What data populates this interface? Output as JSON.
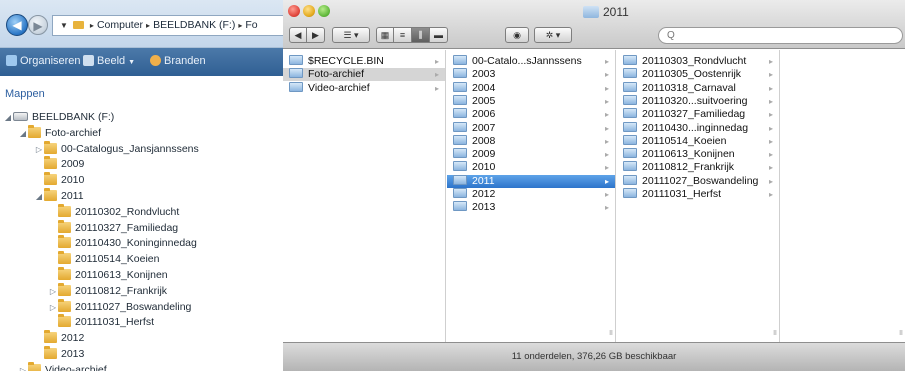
{
  "windows": {
    "address": [
      "Computer",
      "BEELDBANK (F:)",
      "Fo"
    ],
    "toolbar": {
      "organize": "Organiseren",
      "view": "Beeld",
      "burn": "Branden"
    },
    "tree_title": "Mappen",
    "tree": [
      {
        "label": "BEELDBANK (F:)",
        "level": 0,
        "expander": "◢",
        "icon": "drive-icon"
      },
      {
        "label": "Foto-archief",
        "level": 1,
        "expander": "◢",
        "icon": "folder-icon"
      },
      {
        "label": "00-Catalogus_Jansjannssens",
        "level": 2,
        "expander": "▷",
        "icon": "folder-icon"
      },
      {
        "label": "2009",
        "level": 2,
        "expander": "",
        "icon": "folder-icon"
      },
      {
        "label": "2010",
        "level": 2,
        "expander": "",
        "icon": "folder-icon"
      },
      {
        "label": "2011",
        "level": 2,
        "expander": "◢",
        "icon": "folder-icon"
      },
      {
        "label": "20110302_Rondvlucht",
        "level": 3,
        "expander": "",
        "icon": "folder-icon"
      },
      {
        "label": "20110327_Familiedag",
        "level": 3,
        "expander": "",
        "icon": "folder-icon"
      },
      {
        "label": "20110430_Koninginnedag",
        "level": 3,
        "expander": "",
        "icon": "folder-icon"
      },
      {
        "label": "20110514_Koeien",
        "level": 3,
        "expander": "",
        "icon": "folder-icon"
      },
      {
        "label": "20110613_Konijnen",
        "level": 3,
        "expander": "",
        "icon": "folder-icon"
      },
      {
        "label": "20110812_Frankrijk",
        "level": 3,
        "expander": "▷",
        "icon": "folder-icon"
      },
      {
        "label": "20111027_Boswandeling",
        "level": 3,
        "expander": "▷",
        "icon": "folder-icon"
      },
      {
        "label": "20111031_Herfst",
        "level": 3,
        "expander": "",
        "icon": "folder-icon"
      },
      {
        "label": "2012",
        "level": 2,
        "expander": "",
        "icon": "folder-icon"
      },
      {
        "label": "2013",
        "level": 2,
        "expander": "",
        "icon": "folder-icon"
      },
      {
        "label": "Video-archief",
        "level": 1,
        "expander": "▷",
        "icon": "folder-icon"
      }
    ]
  },
  "finder": {
    "title": "2011",
    "search_placeholder": "Q",
    "sidebar": [
      {
        "label": "$RECYCLE.BIN",
        "arrow": "▸",
        "state": ""
      },
      {
        "label": "Foto-archief",
        "arrow": "▸",
        "state": "gray"
      },
      {
        "label": "Video-archief",
        "arrow": "▸",
        "state": ""
      }
    ],
    "col1": [
      {
        "label": "00-Catalo...sJannssens",
        "state": ""
      },
      {
        "label": "2003",
        "state": ""
      },
      {
        "label": "2004",
        "state": ""
      },
      {
        "label": "2005",
        "state": ""
      },
      {
        "label": "2006",
        "state": ""
      },
      {
        "label": "2007",
        "state": ""
      },
      {
        "label": "2008",
        "state": ""
      },
      {
        "label": "2009",
        "state": ""
      },
      {
        "label": "2010",
        "state": ""
      },
      {
        "label": "2011",
        "state": "blue"
      },
      {
        "label": "2012",
        "state": ""
      },
      {
        "label": "2013",
        "state": ""
      }
    ],
    "col2": [
      {
        "label": "20110303_Rondvlucht"
      },
      {
        "label": "20110305_Oostenrijk"
      },
      {
        "label": "20110318_Carnaval"
      },
      {
        "label": "20110320...suitvoering"
      },
      {
        "label": "20110327_Familiedag"
      },
      {
        "label": "20110430...inginnedag"
      },
      {
        "label": "20110514_Koeien"
      },
      {
        "label": "20110613_Konijnen"
      },
      {
        "label": "20110812_Frankrijk"
      },
      {
        "label": "20111027_Boswandeling"
      },
      {
        "label": "20111031_Herfst"
      }
    ],
    "status": "11 onderdelen, 376,26 GB beschikbaar"
  }
}
